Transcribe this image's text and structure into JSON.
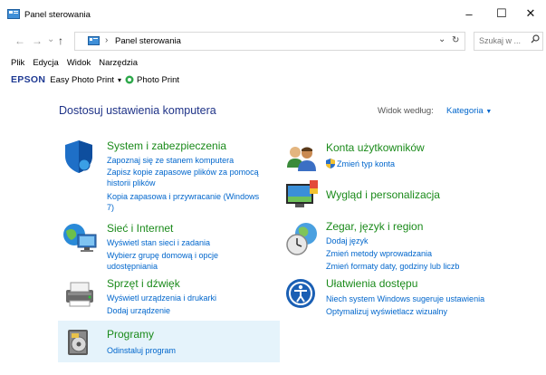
{
  "window": {
    "title": "Panel sterowania",
    "minimize": "–",
    "maximize": "☐",
    "close": "✕"
  },
  "address": {
    "breadcrumb_sep": "›",
    "location": "Panel sterowania",
    "search_placeholder": "Szukaj w ...",
    "refresh": "↻",
    "dropdown": "⌄"
  },
  "nav": {
    "back": "←",
    "forward": "→",
    "recent": "⌄",
    "up": "↑"
  },
  "menu": [
    "Plik",
    "Edycja",
    "Widok",
    "Narzędzia"
  ],
  "epson": {
    "brand": "EPSON",
    "easy_photo_print": "Easy Photo Print",
    "arrow": "▾",
    "photo_print": "Photo Print"
  },
  "header": {
    "title": "Dostosuj ustawienia komputera",
    "view_by_label": "Widok według:",
    "view_by_value": "Kategoria",
    "view_by_arrow": "▼"
  },
  "categories_left": [
    {
      "title": "System i zabezpieczenia",
      "links": [
        "Zapoznaj się ze stanem komputera",
        "Zapisz kopie zapasowe plików za pomocą",
        "historii plików",
        "Kopia zapasowa i przywracanie (Windows",
        "7)"
      ]
    },
    {
      "title": "Sieć i Internet",
      "links": [
        "Wyświetl stan sieci i zadania",
        "Wybierz grupę domową i opcje",
        "udostępniania"
      ]
    },
    {
      "title": "Sprzęt i dźwięk",
      "links": [
        "Wyświetl urządzenia i drukarki",
        "Dodaj urządzenie"
      ]
    },
    {
      "title": "Programy",
      "links": [
        "Odinstaluj program"
      ]
    }
  ],
  "categories_right": [
    {
      "title": "Konta użytkowników",
      "links": [
        "Zmień typ konta"
      ]
    },
    {
      "title": "Wygląd i personalizacja",
      "links": []
    },
    {
      "title": "Zegar, język i region",
      "links": [
        "Dodaj język",
        "Zmień metody wprowadzania",
        "Zmień formaty daty, godziny lub liczb"
      ]
    },
    {
      "title": "Ułatwienia dostępu",
      "links": [
        "Niech system Windows sugeruje ustawienia",
        "Optymalizuj wyświetlacz wizualny"
      ]
    }
  ]
}
